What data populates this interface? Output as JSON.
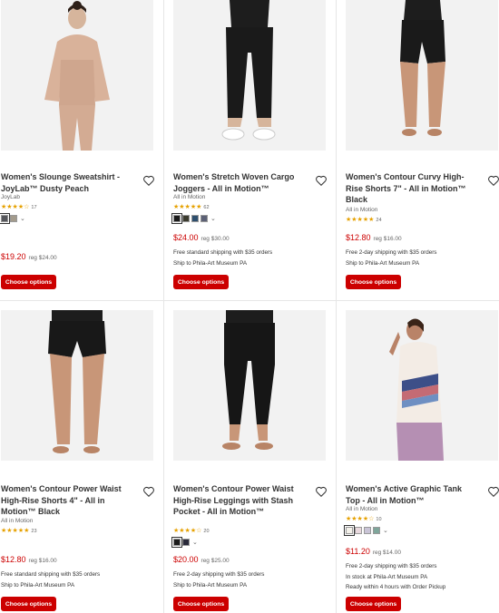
{
  "colors": {
    "accent": "#cc0000",
    "star": "#e6a100",
    "shipping": "#008300"
  },
  "products": [
    {
      "title": "Women's Slounge Sweatshirt - JoyLab™ Dusty Peach",
      "brand": "JoyLab",
      "stars": "★★★★☆",
      "rating_count": "17",
      "swatches": [
        "#55565b",
        "#a39b8c"
      ],
      "price": "$19.20",
      "reg_price": "reg $24.00",
      "shipping": [],
      "button": "Choose options"
    },
    {
      "title": "Women's Stretch Woven Cargo Joggers - All in Motion™",
      "brand": "All in Motion",
      "stars": "★★★★★",
      "rating_count": "62",
      "swatches": [
        "#1b1b1b",
        "#3b3b2e",
        "#2e4f6e",
        "#5c6176"
      ],
      "price": "$24.00",
      "reg_price": "reg $30.00",
      "shipping": [
        "Free standard shipping with $35 orders",
        "Ship to Phila-Art Museum PA"
      ],
      "button": "Choose options"
    },
    {
      "title": "Women's Contour Curvy High-Rise Shorts 7\" - All in Motion™ Black",
      "brand": "All in Motion",
      "stars": "★★★★★",
      "rating_count": "24",
      "swatches": [],
      "price": "$12.80",
      "reg_price": "reg $16.00",
      "shipping": [
        "Free 2-day shipping with $35 orders",
        "Ship to Phila-Art Museum PA"
      ],
      "button": "Choose options"
    },
    {
      "title": "Women's Contour Power Waist High-Rise Shorts 4\" - All in Motion™ Black",
      "brand": "All in Motion",
      "stars": "★★★★★",
      "rating_count": "23",
      "swatches": [],
      "price": "$12.80",
      "reg_price": "reg $16.00",
      "shipping": [
        "Free standard shipping with $35 orders",
        "Ship to Phila-Art Museum PA"
      ],
      "button": "Choose options"
    },
    {
      "title": "Women's Contour Power Waist High-Rise Leggings with Stash Pocket - All in Motion™",
      "brand": "",
      "stars": "★★★★☆",
      "rating_count": "20",
      "swatches": [
        "#1b1b1b",
        "#2a2a3a"
      ],
      "price": "$20.00",
      "reg_price": "reg $25.00",
      "shipping": [
        "Free 2-day shipping with $35 orders",
        "Ship to Phila-Art Museum PA"
      ],
      "button": "Choose options"
    },
    {
      "title": "Women's Active Graphic Tank Top - All in Motion™",
      "brand": "All in Motion",
      "stars": "★★★★☆",
      "rating_count": "10",
      "swatches": [
        "#f4f1ea",
        "#e9d9de",
        "#c9c4d6",
        "#7fa69b"
      ],
      "price": "$11.20",
      "reg_price": "reg $14.00",
      "shipping": [
        "Free 2-day shipping with $35 orders",
        "In stock at Phila-Art Museum PA",
        "Ready within 4 hours with Order Pickup"
      ],
      "button": "Choose options"
    }
  ]
}
